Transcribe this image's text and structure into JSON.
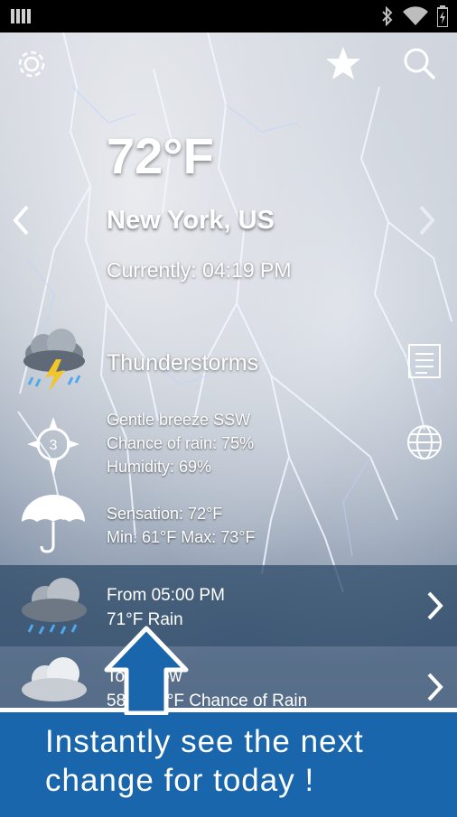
{
  "weather": {
    "temperature": "72°F",
    "city": "New York, US",
    "current_time": "Currently: 04:19 PM",
    "condition": "Thunderstorms",
    "wind": "Gentle breeze SSW",
    "rain_chance": "Chance of rain: 75%",
    "humidity": "Humidity: 69%",
    "sensation": "Sensation: 72°F",
    "min_max": "Min: 61°F Max: 73°F",
    "wind_speed_number": "3"
  },
  "forecast": [
    {
      "time": "From 05:00 PM",
      "summary": "71°F Rain"
    },
    {
      "time": "Tomorrow",
      "summary": "58°F 73°F Chance of Rain"
    }
  ],
  "promo": {
    "line1": "Instantly see the next",
    "line2": "change for today !"
  },
  "colors": {
    "banner": "#1a66ac",
    "row_highlight": "#324e6c"
  },
  "icons": [
    "settings-icon",
    "star-icon",
    "search-icon",
    "chevron-left-icon",
    "chevron-right-icon",
    "thunderstorm-icon",
    "details-icon",
    "wind-compass-icon",
    "globe-icon",
    "umbrella-icon",
    "rain-cloud-icon",
    "cloud-icon",
    "up-arrow-icon",
    "signal-icon",
    "bluetooth-icon",
    "wifi-icon",
    "battery-icon"
  ]
}
